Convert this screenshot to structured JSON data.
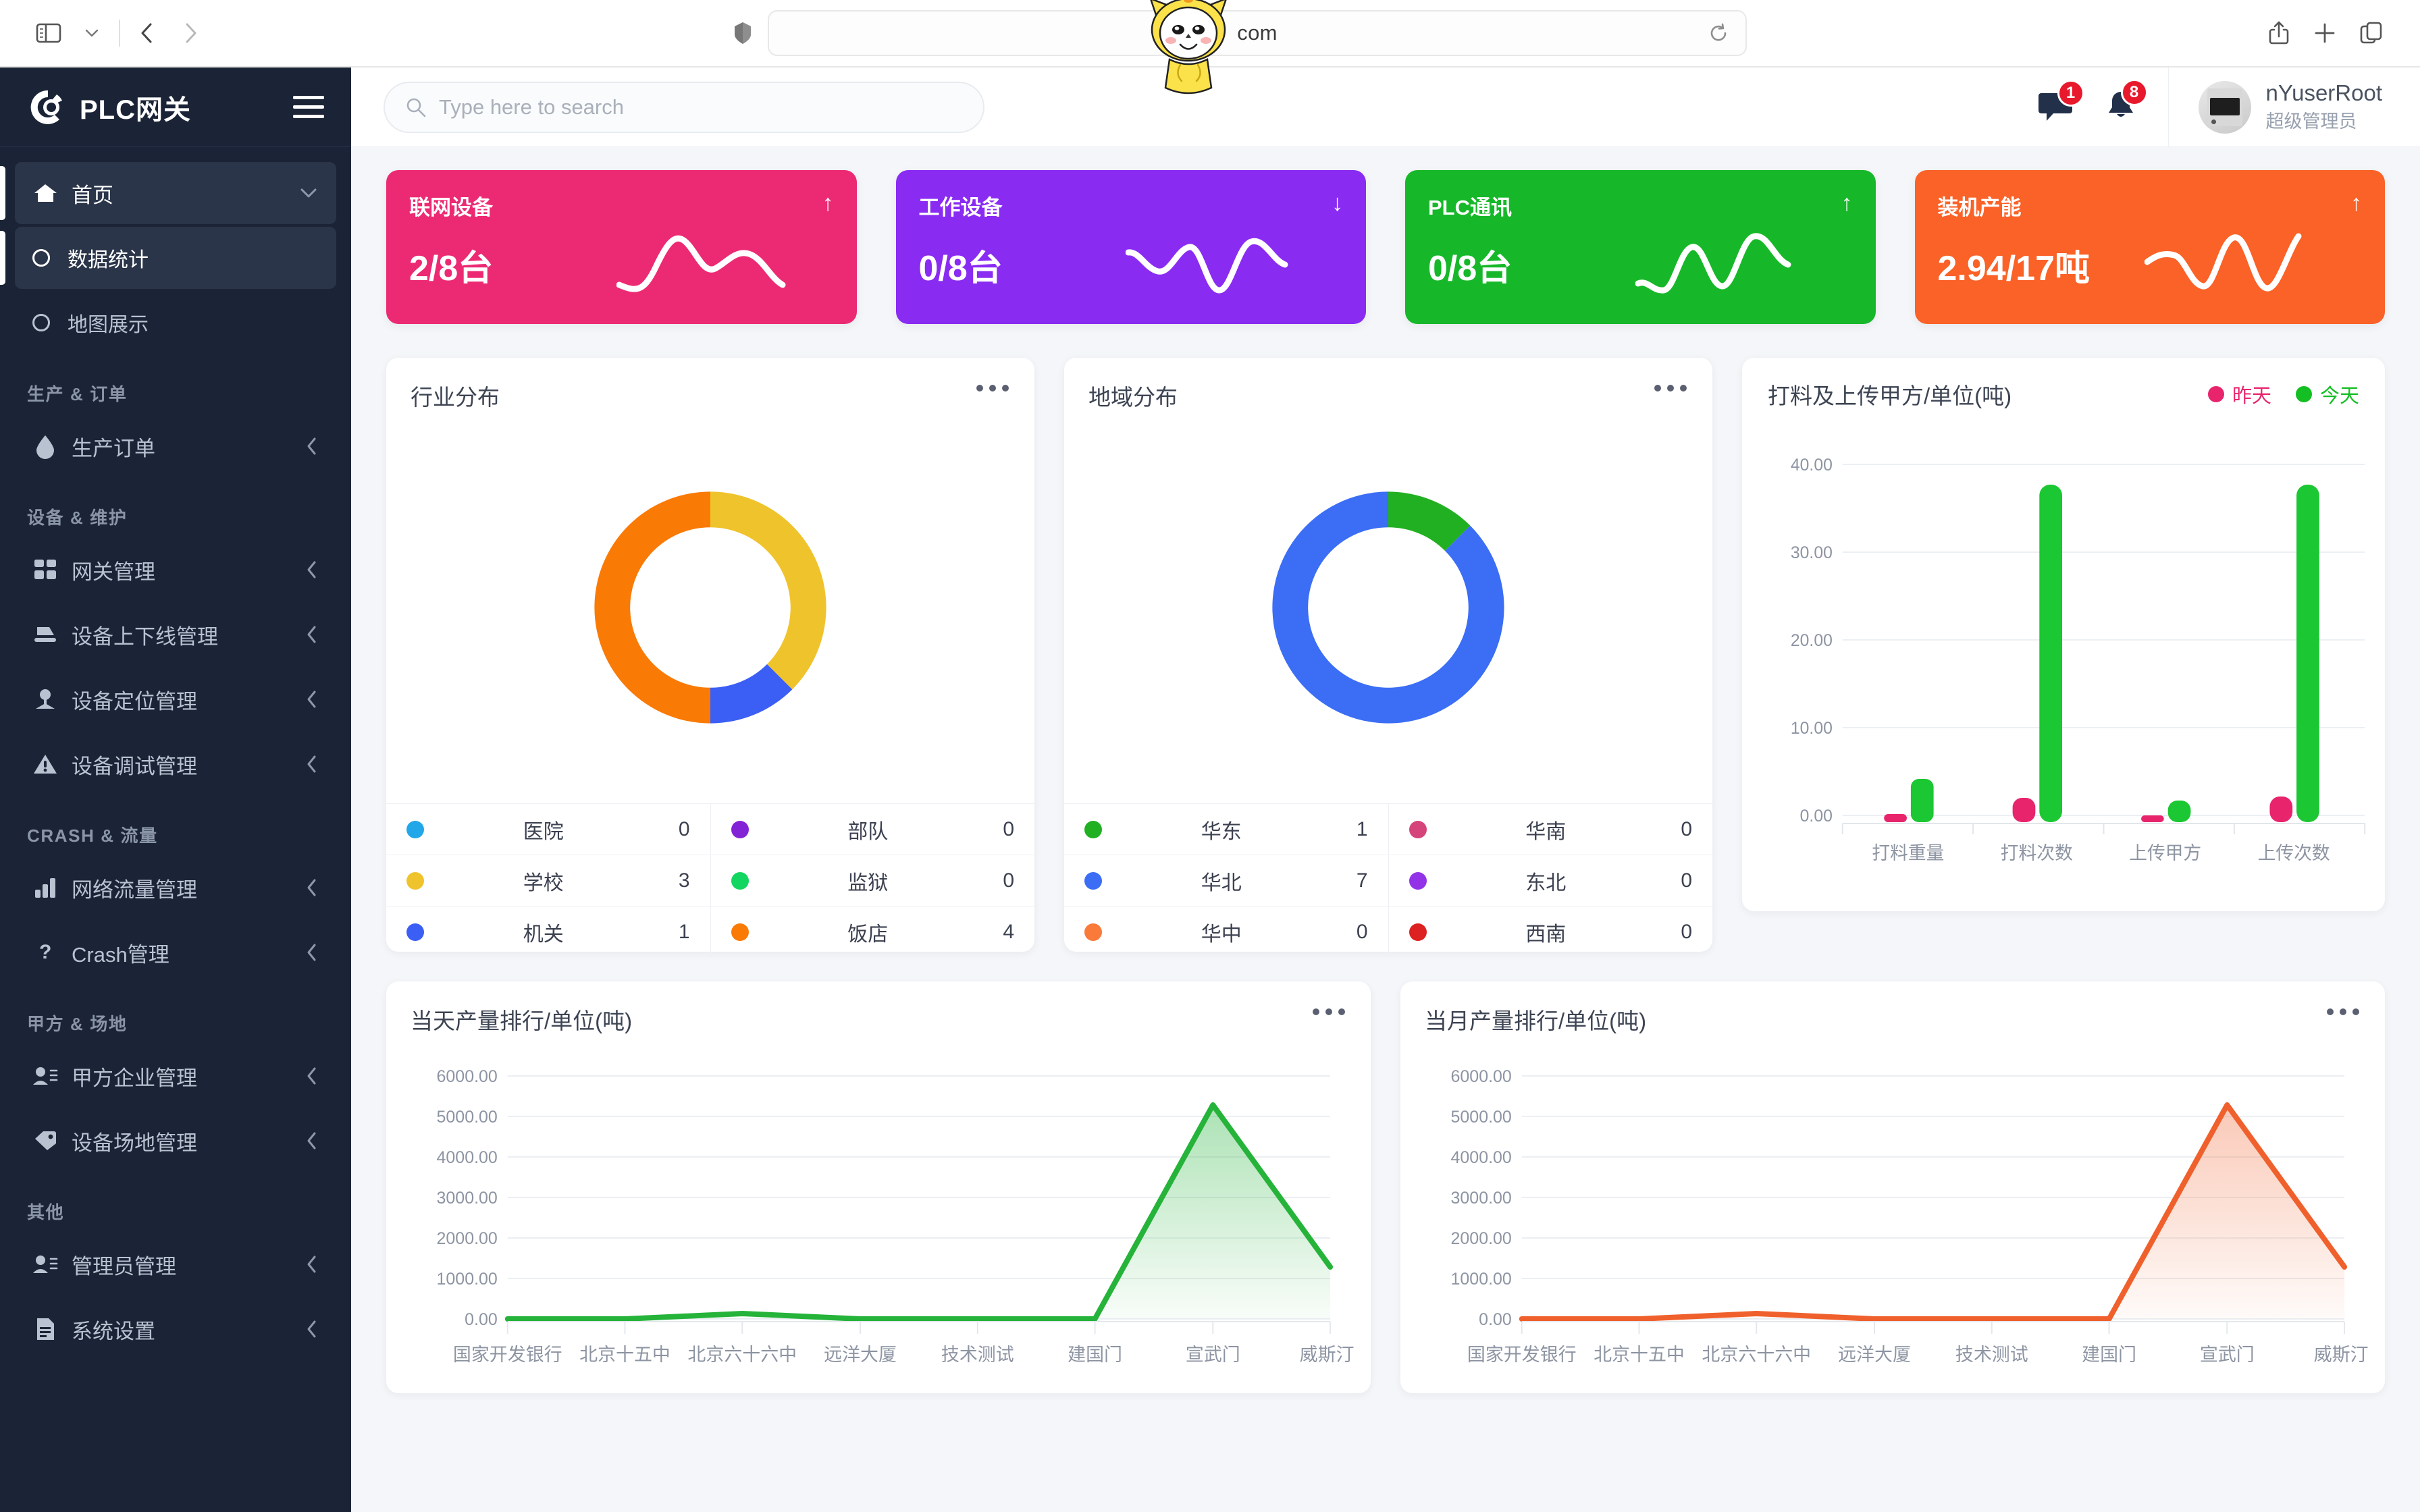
{
  "browser": {
    "url_text": "com",
    "sidebar_toggle_icon": "sidebar-toggle-icon",
    "back_icon": "back-chevron-icon",
    "forward_icon": "forward-chevron-icon",
    "shield_icon": "privacy-shield-icon",
    "reload_icon": "reload-icon",
    "share_icon": "share-icon",
    "newtab_icon": "plus-icon",
    "tabs_icon": "tabs-icon"
  },
  "sidebar": {
    "brand": "PLC网关",
    "hamburger_icon": "hamburger-icon",
    "items": [
      {
        "label": "首页",
        "icon": "home-icon",
        "type": "parent",
        "active": true,
        "chev": "chevron-down-icon"
      },
      {
        "label": "数据统计",
        "icon": "circle-outline-icon",
        "type": "sub",
        "active": true
      },
      {
        "label": "地图展示",
        "icon": "circle-outline-icon",
        "type": "sub",
        "active": false
      }
    ],
    "groups": [
      {
        "title": "生产 & 订单",
        "items": [
          {
            "label": "生产订单",
            "icon": "droplet-icon",
            "chev": "chevron-left-icon"
          }
        ]
      },
      {
        "title": "设备 & 维护",
        "items": [
          {
            "label": "网关管理",
            "icon": "grid-icon",
            "chev": "chevron-left-icon"
          },
          {
            "label": "设备上下线管理",
            "icon": "device-icon",
            "chev": "chevron-left-icon"
          },
          {
            "label": "设备定位管理",
            "icon": "pin-icon",
            "chev": "chevron-left-icon"
          },
          {
            "label": "设备调试管理",
            "icon": "warning-triangle-icon",
            "chev": "chevron-left-icon"
          }
        ]
      },
      {
        "title": "CRASH & 流量",
        "items": [
          {
            "label": "网络流量管理",
            "icon": "bar-chart-icon",
            "chev": "chevron-left-icon"
          },
          {
            "label": "Crash管理",
            "icon": "question-mark-icon",
            "chev": "chevron-left-icon"
          }
        ]
      },
      {
        "title": "甲方 & 场地",
        "items": [
          {
            "label": "甲方企业管理",
            "icon": "users-list-icon",
            "chev": "chevron-left-icon"
          },
          {
            "label": "设备场地管理",
            "icon": "tag-icon",
            "chev": "chevron-left-icon"
          }
        ]
      },
      {
        "title": "其他",
        "items": [
          {
            "label": "管理员管理",
            "icon": "users-list-icon",
            "chev": "chevron-left-icon"
          },
          {
            "label": "系统设置",
            "icon": "settings-doc-icon",
            "chev": "chevron-left-icon"
          }
        ]
      }
    ]
  },
  "topbar": {
    "search_placeholder": "Type here to search",
    "search_value": "",
    "search_icon": "search-icon",
    "message_icon": "message-icon",
    "message_badge": "1",
    "bell_icon": "bell-icon",
    "bell_badge": "8",
    "user_name": "nYuserRoot",
    "user_role": "超级管理员",
    "avatar_icon": "plc-device-avatar"
  },
  "stat_cards": [
    {
      "title": "联网设备",
      "value": "2/8台",
      "arrow": "↑",
      "color": "#ec2a73"
    },
    {
      "title": "工作设备",
      "value": "0/8台",
      "arrow": "↓",
      "color": "#8a2bf2"
    },
    {
      "title": "PLC通讯",
      "value": "0/8台",
      "arrow": "↑",
      "color": "#16b829"
    },
    {
      "title": "装机产能",
      "value": "2.94/17吨",
      "arrow": "↑",
      "color": "#fa6227"
    }
  ],
  "chart_data": [
    {
      "type": "pie",
      "title": "行业分布",
      "menu_icon": "more-dots-icon",
      "categories": [
        "医院",
        "学校",
        "机关",
        "部队",
        "监狱",
        "饭店"
      ],
      "values": [
        0,
        3,
        1,
        0,
        0,
        4
      ],
      "colors": [
        "#22a7e8",
        "#efc32c",
        "#3b5ef5",
        "#8323d6",
        "#13d660",
        "#fa7a06"
      ],
      "legend_layout": "two-column-table"
    },
    {
      "type": "pie",
      "title": "地域分布",
      "menu_icon": "more-dots-icon",
      "categories": [
        "华东",
        "华北",
        "华中",
        "华南",
        "东北",
        "西南"
      ],
      "values": [
        1,
        7,
        0,
        0,
        0,
        0
      ],
      "colors": [
        "#21b022",
        "#3b6ef5",
        "#fa7a3a",
        "#d5447a",
        "#9233e8",
        "#dd2020"
      ],
      "legend_layout": "two-column-table"
    },
    {
      "type": "bar",
      "title": "打料及上传甲方/单位(吨)",
      "categories": [
        "打料重量",
        "打料次数",
        "上传甲方",
        "上传次数"
      ],
      "series": [
        {
          "name": "昨天",
          "values": [
            0.18,
            2.2,
            0.15,
            2.3
          ],
          "color": "#e8246d"
        },
        {
          "name": "今天",
          "values": [
            4.2,
            37.8,
            1.9,
            37.8
          ],
          "color": "#1bc732"
        }
      ],
      "ylabel": "",
      "ylim": [
        0,
        40
      ],
      "yticks": [
        "0.00",
        "10.00",
        "20.00",
        "30.00",
        "40.00"
      ],
      "legend_position": "top-right",
      "grid": true
    },
    {
      "type": "area",
      "title": "当天产量排行/单位(吨)",
      "menu_icon": "more-dots-icon",
      "categories": [
        "国家开发银行",
        "北京十五中",
        "北京六十六中",
        "远洋大厦",
        "技术测试",
        "建国门",
        "宣武门",
        "威斯汀"
      ],
      "values": [
        0,
        0,
        130,
        0,
        0,
        0,
        5280,
        1280
      ],
      "color": "#25b33a",
      "ylim": [
        0,
        6000
      ],
      "yticks": [
        "0.00",
        "1000.00",
        "2000.00",
        "3000.00",
        "4000.00",
        "5000.00",
        "6000.00"
      ],
      "grid": true
    },
    {
      "type": "area",
      "title": "当月产量排行/单位(吨)",
      "menu_icon": "more-dots-icon",
      "categories": [
        "国家开发银行",
        "北京十五中",
        "北京六十六中",
        "远洋大厦",
        "技术测试",
        "建国门",
        "宣武门",
        "威斯汀"
      ],
      "values": [
        0,
        0,
        130,
        0,
        0,
        0,
        5280,
        1280
      ],
      "color": "#f0602c",
      "ylim": [
        0,
        6000
      ],
      "yticks": [
        "0.00",
        "1000.00",
        "2000.00",
        "3000.00",
        "4000.00",
        "5000.00",
        "6000.00"
      ],
      "grid": true
    }
  ]
}
